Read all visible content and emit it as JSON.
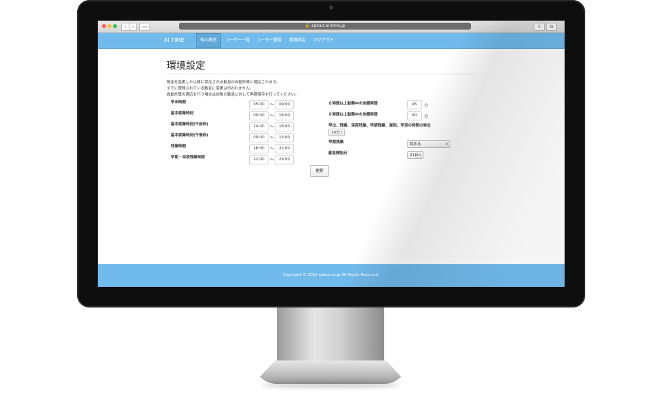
{
  "browser": {
    "url": "splout.ai-time.jp",
    "back_glyph": "‹",
    "forward_glyph": "›",
    "sidebar_glyph": "▭",
    "share_glyph": "⇪",
    "tabs_glyph": "⧉"
  },
  "nav": {
    "brand": "AI TIME",
    "items": [
      {
        "label": "個人勤怠",
        "active": true
      },
      {
        "label": "ユーザー一覧",
        "active": false
      },
      {
        "label": "ユーザー登録",
        "active": false
      },
      {
        "label": "環境設定",
        "active": false
      },
      {
        "label": "ログアウト",
        "active": false
      }
    ]
  },
  "page": {
    "title": "環境設定",
    "description": [
      "設定を変更した以降に保存される勤怠の自動計算に適応されます。",
      "すでに登録されている勤怠に変更は行われません。",
      "自動計算の適応を行う場合は対象の勤怠に対して再度保存を行ってください。"
    ]
  },
  "left_settings": [
    {
      "label": "早出時間",
      "from": "05:00",
      "to": "09:00"
    },
    {
      "label": "基本就業時刻",
      "from": "09:00",
      "to": "18:00"
    },
    {
      "label": "基本就業時刻(午前休)",
      "from": "14:00",
      "to": "18:00"
    },
    {
      "label": "基本就業時刻(午後休)",
      "from": "09:00",
      "to": "13:00"
    },
    {
      "label": "残業時間",
      "from": "18:00",
      "to": "22:00"
    },
    {
      "label": "早朝・深夜残業時間",
      "from": "22:00",
      "to": "29:00"
    }
  ],
  "tilde": "〜",
  "right_settings": {
    "break6": {
      "label": "６時間以上勤務中の休憩時間",
      "value": "45",
      "unit": "分"
    },
    "break8": {
      "label": "８時間以上勤務中の休憩時間",
      "value": "60",
      "unit": "分"
    },
    "unit_label": "早出、残業、深夜残業、早朝残業、遅刻、早退の時間の単位",
    "unit_value": "30分",
    "early_ot_label": "早朝残業",
    "early_ot_value": "認める",
    "start_day_label": "勤怠開始日",
    "start_day_value": "21日"
  },
  "actions": {
    "update": "更新"
  },
  "footer": {
    "copyright": "Copyright © 2016 splout.co.jp All Rights Reserved."
  }
}
